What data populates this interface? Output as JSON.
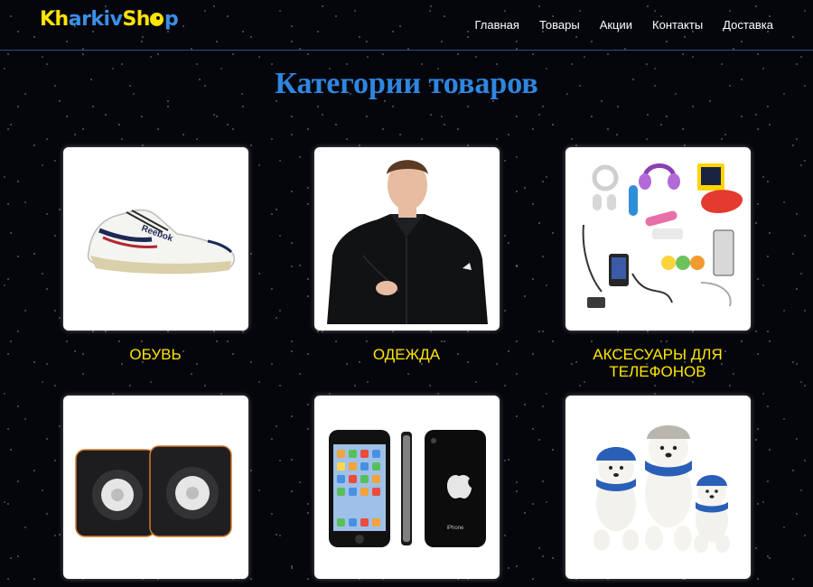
{
  "site": {
    "logo": {
      "part1": "Kh",
      "part2": "arkiv",
      "part3": "Sh",
      "part4": "p"
    },
    "colors": {
      "accent": "#2f86e0",
      "caption": "#ffe600",
      "logo_yellow": "#ffe400",
      "logo_blue": "#3a8fe6"
    }
  },
  "nav": {
    "items": [
      {
        "label": "Главная"
      },
      {
        "label": "Товары"
      },
      {
        "label": "Акции"
      },
      {
        "label": "Контакты"
      },
      {
        "label": "Доставка"
      }
    ]
  },
  "main": {
    "title": "Категории товаров",
    "categories": [
      {
        "label": "ОБУВЬ",
        "icon": "sneaker-image"
      },
      {
        "label": "ОДЕЖДА",
        "icon": "jacket-image"
      },
      {
        "label": "АКСЕСУАРЫ ДЛЯ ТЕЛЕФОНОВ",
        "icon": "phone-accessories-image"
      },
      {
        "label": "",
        "icon": "speakers-image"
      },
      {
        "label": "",
        "icon": "smartphone-image"
      },
      {
        "label": "",
        "icon": "plush-toys-image"
      }
    ]
  }
}
